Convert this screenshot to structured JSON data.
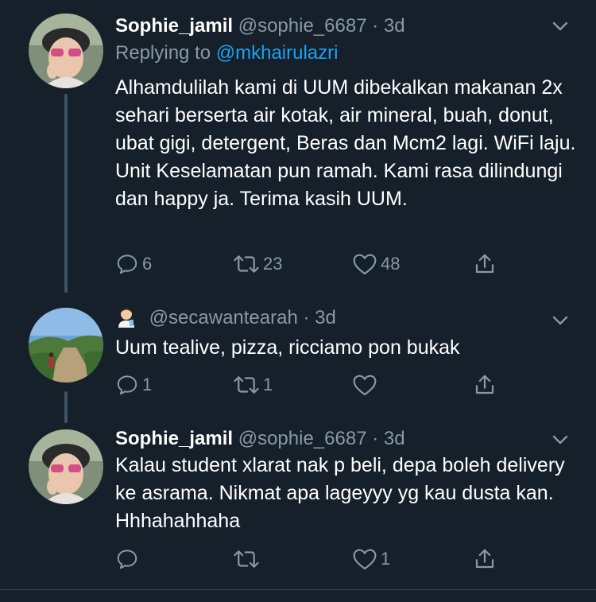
{
  "tweets": [
    {
      "name": "Sophie_jamil",
      "handle": "@sophie_6687",
      "dot": "·",
      "time": "3d",
      "replying_label": "Replying to",
      "replying_to": "@mkhairulazri",
      "text": "Alhamdulilah kami di UUM dibekalkan makanan 2x sehari berserta air kotak, air mineral, buah, donut, ubat gigi, detergent, Beras dan Mcm2 lagi. WiFi laju. Unit Keselamatan pun ramah. Kami rasa dilindungi dan happy ja. Terima kasih UUM.",
      "replies": "6",
      "retweets": "23",
      "likes": "48"
    },
    {
      "name": "",
      "handle": "@secawantearah",
      "dot": "·",
      "time": "3d",
      "text": "Uum tealive, pizza, ricciamo pon bukak",
      "replies": "1",
      "retweets": "1",
      "likes": ""
    },
    {
      "name": "Sophie_jamil",
      "handle": "@sophie_6687",
      "dot": "·",
      "time": "3d",
      "text": "Kalau student xlarat nak p beli, depa boleh delivery ke asrama. Nikmat apa lageyyy yg kau dusta kan. Hhhahahhaha",
      "replies": "",
      "retweets": "",
      "likes": "1"
    }
  ],
  "colors": {
    "background": "#15202b",
    "secondary_text": "#8899a6",
    "mention": "#1da1f2",
    "thread_line": "#3d5466"
  }
}
